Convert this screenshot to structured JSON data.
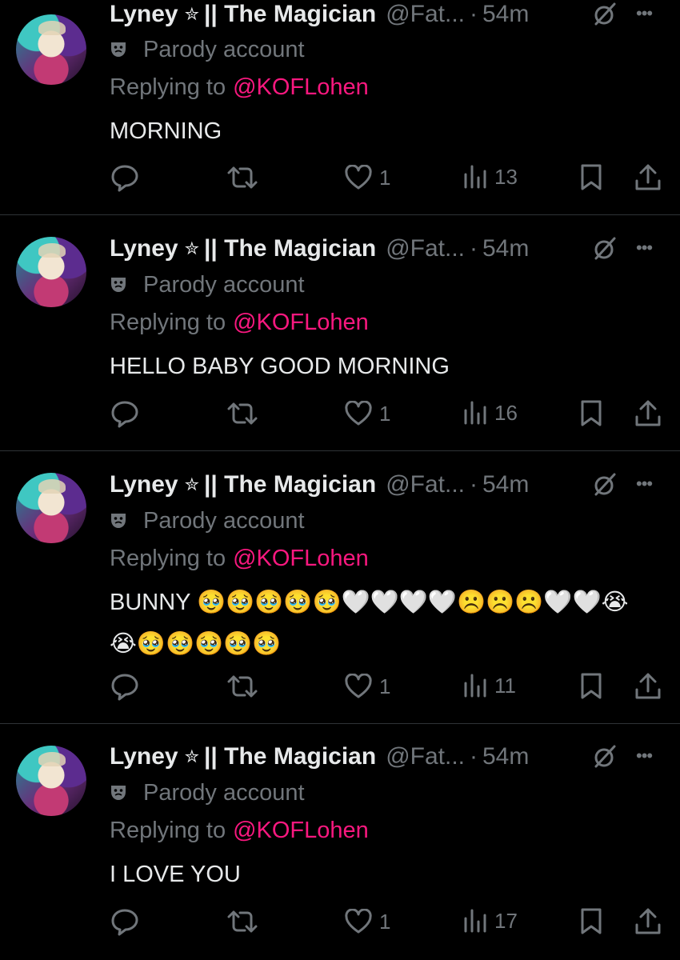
{
  "author": {
    "name": "Lyney",
    "name_suffix": "|| The Magician",
    "star_icon": "star-icon",
    "handle": "@Fat...",
    "dot": "·",
    "time": "54m",
    "parody_label": "Parody account",
    "replying_prefix": "Replying to",
    "replying_to": "@KOFLohen"
  },
  "colors": {
    "background": "#000000",
    "text": "#e7e9ea",
    "muted": "#71767b",
    "mention": "#f9187f",
    "divider": "#2f3336"
  },
  "tweets": [
    {
      "text": "MORNING",
      "likes": "1",
      "views": "13"
    },
    {
      "text": "HELLO BABY GOOD MORNING",
      "likes": "1",
      "views": "16"
    },
    {
      "text": "BUNNY 🥹🥹🥹🥹🥹🤍🤍🤍🤍☹️☹️☹️🤍🤍😭😭🥹🥹🥹🥹🥹",
      "likes": "1",
      "views": "11"
    },
    {
      "text": "I LOVE YOU",
      "likes": "1",
      "views": "17"
    }
  ]
}
